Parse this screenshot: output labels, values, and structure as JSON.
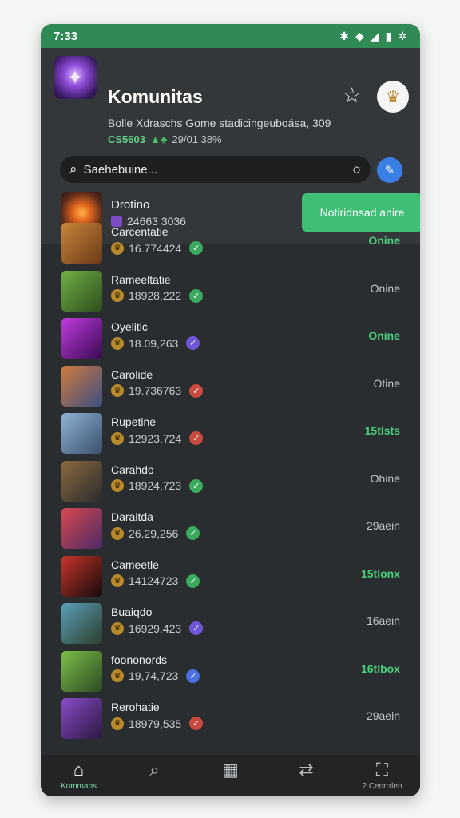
{
  "statusbar": {
    "time": "7:33",
    "icons": [
      "bluetooth-icon",
      "wifi-icon",
      "signal-icon",
      "battery-icon",
      "settings-icon"
    ]
  },
  "header": {
    "title": "Komunitas",
    "subtitle": "Bolle Xdraschs Gome stadicingeuboása, 309",
    "subline_tag": "CS5603",
    "subline_count": "29/01 38%"
  },
  "search": {
    "placeholder": "Saehebuine..."
  },
  "featured": {
    "name": "Drotino",
    "count": "24663 3036",
    "button_label": "Notiridnsad anire"
  },
  "communities": [
    {
      "name": "Carcentatie",
      "count": "16.774424",
      "verified": "green",
      "status": "Onine",
      "status_color": "green",
      "thumb": [
        "#c9863a",
        "#6b3a18"
      ]
    },
    {
      "name": "Rameeltatie",
      "count": "18928,222",
      "verified": "green",
      "status": "Onine",
      "status_color": "gray",
      "thumb": [
        "#6fb043",
        "#2f4d1e"
      ]
    },
    {
      "name": "Oyelitic",
      "count": "18.09,263",
      "verified": "purple",
      "status": "Onine",
      "status_color": "green",
      "thumb": [
        "#c13be0",
        "#3a0a52"
      ]
    },
    {
      "name": "Carolide",
      "count": "19.736763",
      "verified": "red",
      "status": "Otine",
      "status_color": "gray",
      "thumb": [
        "#d07b3e",
        "#3c4f80"
      ]
    },
    {
      "name": "Rupetine",
      "count": "12923,724",
      "verified": "red",
      "status": "15tlsts",
      "status_color": "green",
      "thumb": [
        "#8fb2d6",
        "#3b4f6b"
      ]
    },
    {
      "name": "Carahdo",
      "count": "18924,723",
      "verified": "green",
      "status": "Ohine",
      "status_color": "gray",
      "thumb": [
        "#8a6a3d",
        "#2b2b30"
      ]
    },
    {
      "name": "Daraitda",
      "count": "26.29,256",
      "verified": "green",
      "status": "29aein",
      "status_color": "gray",
      "thumb": [
        "#d9484f",
        "#4a2a66"
      ]
    },
    {
      "name": "Cameetle",
      "count": "14124723",
      "verified": "green",
      "status": "15tlonx",
      "status_color": "green",
      "thumb": [
        "#c8342a",
        "#120c0c"
      ]
    },
    {
      "name": "Buaiqdo",
      "count": "16929,423",
      "verified": "purple",
      "status": "16aein",
      "status_color": "gray",
      "thumb": [
        "#5aa0b8",
        "#2c3e2c"
      ]
    },
    {
      "name": "foononords",
      "count": "19,74,723",
      "verified": "blue",
      "status": "16tlbox",
      "status_color": "green",
      "thumb": [
        "#7cbf4a",
        "#2d4a22"
      ]
    },
    {
      "name": "Rerohatie",
      "count": "18979,535",
      "verified": "red",
      "status": "29aein",
      "status_color": "gray",
      "thumb": [
        "#8a4bc9",
        "#2a1840"
      ]
    }
  ],
  "colors": {
    "green": "#3aaa5c",
    "purple": "#6f55d8",
    "red": "#c94a3f",
    "blue": "#4a6fe0"
  },
  "nav": [
    {
      "label": "Kommaps",
      "icon": "home-icon",
      "glyph": "⌂",
      "active": true
    },
    {
      "label": "",
      "icon": "search-icon",
      "glyph": "⌕",
      "active": false
    },
    {
      "label": "",
      "icon": "grid-icon",
      "glyph": "▦",
      "active": false
    },
    {
      "label": "",
      "icon": "swap-icon",
      "glyph": "⇄",
      "active": false
    },
    {
      "label": "2 Cenrrrlen",
      "icon": "game-icon",
      "glyph": "⛶",
      "active": false
    }
  ]
}
